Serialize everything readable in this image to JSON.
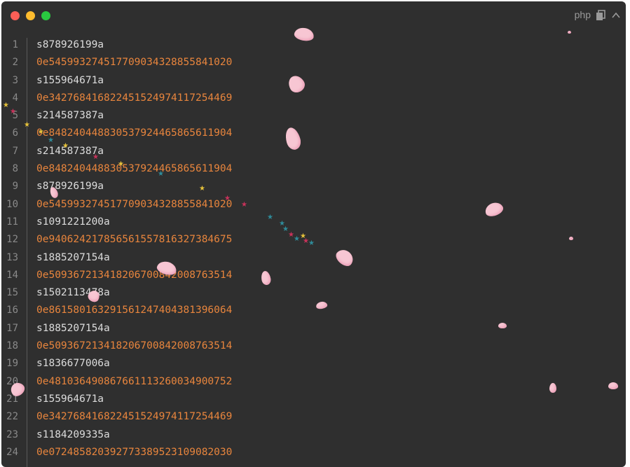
{
  "window": {
    "language_label": "php",
    "icons": {
      "copy": "copy-icon",
      "collapse": "chevron-up-icon"
    },
    "colors": {
      "background": "#2f2f2f",
      "string_s": "#dcdcdc",
      "string_e": "#e8853d",
      "petal": "#f7c6d3"
    }
  },
  "code": {
    "lines": [
      {
        "n": "1",
        "text": "s878926199a",
        "kind": "s"
      },
      {
        "n": "2",
        "text": "0e545993274517709034328855841020",
        "kind": "e"
      },
      {
        "n": "3",
        "text": "s155964671a",
        "kind": "s"
      },
      {
        "n": "4",
        "text": "0e342768416822451524974117254469",
        "kind": "e"
      },
      {
        "n": "5",
        "text": "s214587387a",
        "kind": "s"
      },
      {
        "n": "6",
        "text": "0e848240448830537924465865611904",
        "kind": "e"
      },
      {
        "n": "7",
        "text": "s214587387a",
        "kind": "s"
      },
      {
        "n": "8",
        "text": "0e848240448830537924465865611904",
        "kind": "e"
      },
      {
        "n": "9",
        "text": "s878926199a",
        "kind": "s"
      },
      {
        "n": "10",
        "text": "0e545993274517709034328855841020",
        "kind": "e"
      },
      {
        "n": "11",
        "text": "s1091221200a",
        "kind": "s"
      },
      {
        "n": "12",
        "text": "0e940624217856561557816327384675",
        "kind": "e"
      },
      {
        "n": "13",
        "text": "s1885207154a",
        "kind": "s"
      },
      {
        "n": "14",
        "text": "0e509367213418206700842008763514",
        "kind": "e"
      },
      {
        "n": "15",
        "text": "s1502113478a",
        "kind": "s"
      },
      {
        "n": "16",
        "text": "0e861580163291561247404381396064",
        "kind": "e"
      },
      {
        "n": "17",
        "text": "s1885207154a",
        "kind": "s"
      },
      {
        "n": "18",
        "text": "0e509367213418206700842008763514",
        "kind": "e"
      },
      {
        "n": "19",
        "text": "s1836677006a",
        "kind": "s"
      },
      {
        "n": "20",
        "text": "0e481036490867661113260034900752",
        "kind": "e"
      },
      {
        "n": "21",
        "text": "s155964671a",
        "kind": "s"
      },
      {
        "n": "22",
        "text": "0e342768416822451524974117254469",
        "kind": "e"
      },
      {
        "n": "23",
        "text": "s1184209335a",
        "kind": "s"
      },
      {
        "n": "24",
        "text": "0e072485820392773389523109082030",
        "kind": "e"
      }
    ]
  }
}
